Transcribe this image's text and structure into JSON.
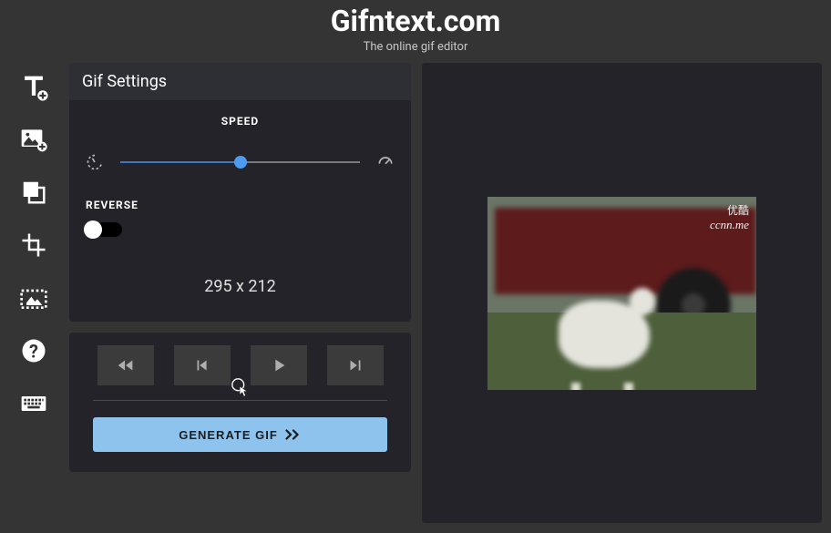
{
  "header": {
    "title": "Gifntext.com",
    "subtitle": "The online gif editor"
  },
  "panel": {
    "title": "Gif Settings",
    "speed_label": "SPEED",
    "reverse_label": "REVERSE",
    "dimensions": "295 x 212"
  },
  "controls": {
    "generate_label": "GENERATE GIF"
  },
  "preview": {
    "watermark_line1": "优酷",
    "watermark_line2": "ccnn.me"
  }
}
